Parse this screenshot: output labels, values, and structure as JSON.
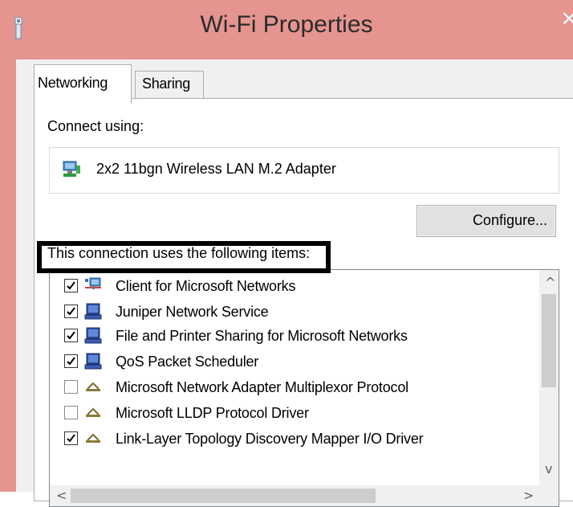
{
  "window": {
    "title": "Wi-Fi Properties",
    "close_glyph": "×",
    "accent_color": "#e5948f"
  },
  "tabs": [
    {
      "label": "Networking",
      "selected": true
    },
    {
      "label": "Sharing",
      "selected": false
    }
  ],
  "connect_using": {
    "label": "Connect using:",
    "adapter_name": "2x2 11bgn Wireless LAN M.2 Adapter",
    "adapter_icon": "network-adapter-icon"
  },
  "configure_button": {
    "label": "Configure..."
  },
  "items_section": {
    "label": "This connection uses the following items:",
    "items": [
      {
        "label": "Client for Microsoft Networks",
        "checked": true,
        "icon": "client-network-icon"
      },
      {
        "label": "Juniper Network Service",
        "checked": true,
        "icon": "service-computer-icon"
      },
      {
        "label": "File and Printer Sharing for Microsoft Networks",
        "checked": true,
        "icon": "service-computer-icon"
      },
      {
        "label": "QoS Packet Scheduler",
        "checked": true,
        "icon": "service-computer-icon"
      },
      {
        "label": "Microsoft Network Adapter Multiplexor Protocol",
        "checked": false,
        "icon": "protocol-icon"
      },
      {
        "label": "Microsoft LLDP Protocol Driver",
        "checked": false,
        "icon": "protocol-icon"
      },
      {
        "label": "Link-Layer Topology Discovery Mapper I/O Driver",
        "checked": true,
        "icon": "protocol-icon"
      }
    ]
  },
  "scroll_arrows": {
    "up": "^",
    "down": "v",
    "left": "<",
    "right": ">"
  },
  "highlighted_item": "Juniper Network Service"
}
